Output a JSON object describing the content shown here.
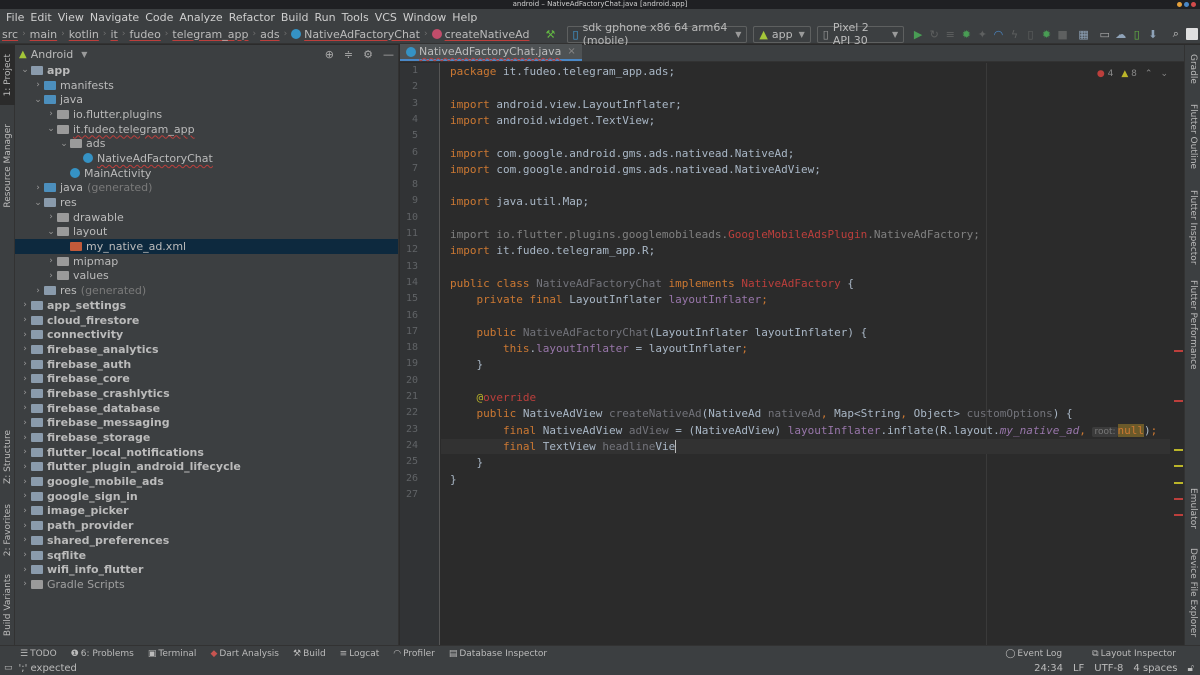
{
  "window": {
    "title": "android – NativeAdFactoryChat.java [android.app]"
  },
  "menu": [
    "File",
    "Edit",
    "View",
    "Navigate",
    "Code",
    "Analyze",
    "Refactor",
    "Build",
    "Run",
    "Tools",
    "VCS",
    "Window",
    "Help"
  ],
  "breadcrumbs": [
    "src",
    "main",
    "kotlin",
    "it",
    "fudeo",
    "telegram_app",
    "ads",
    "NativeAdFactoryChat",
    "createNativeAd"
  ],
  "toolbar": {
    "device_combo": "sdk gphone x86 64 arm64 (mobile)",
    "config_combo": "app",
    "avd_combo": "Pixel 2 API 30",
    "icons": [
      "hammer-icon",
      "run-icon",
      "apply-changes-icon",
      "apply-code-changes-icon",
      "debug-icon",
      "attach-debugger-icon",
      "profile-icon",
      "sync-icon",
      "device-icon",
      "attach-process-icon",
      "stop-icon",
      "project-structure-icon",
      "sdk-manager-icon",
      "avd-manager-icon",
      "sync-gradle-icon",
      "device-manager-icon",
      "search-icon",
      "account-icon"
    ]
  },
  "left_strip": {
    "tabs": [
      "1: Project",
      "Resource Manager",
      "Z: Structure",
      "2: Favorites",
      "Build Variants"
    ]
  },
  "project": {
    "view_mode": "Android",
    "tree": [
      {
        "label": "app",
        "depth": 0,
        "expanded": true,
        "icon": "module",
        "bold": true
      },
      {
        "label": "manifests",
        "depth": 1,
        "expanded": false,
        "icon": "folder"
      },
      {
        "label": "java",
        "depth": 1,
        "expanded": true,
        "icon": "folder"
      },
      {
        "label": "io.flutter.plugins",
        "depth": 2,
        "expanded": false,
        "icon": "package"
      },
      {
        "label": "it.fudeo.telegram_app",
        "depth": 2,
        "expanded": true,
        "icon": "package",
        "error": true
      },
      {
        "label": "ads",
        "depth": 3,
        "expanded": true,
        "icon": "package"
      },
      {
        "label": "NativeAdFactoryChat",
        "depth": 4,
        "icon": "class",
        "error": true
      },
      {
        "label": "MainActivity",
        "depth": 3,
        "icon": "activity"
      },
      {
        "label": "java",
        "suffix": "(generated)",
        "depth": 1,
        "expanded": false,
        "icon": "folder-gen"
      },
      {
        "label": "res",
        "depth": 1,
        "expanded": true,
        "icon": "res"
      },
      {
        "label": "drawable",
        "depth": 2,
        "expanded": false,
        "icon": "package"
      },
      {
        "label": "layout",
        "depth": 2,
        "expanded": true,
        "icon": "package"
      },
      {
        "label": "my_native_ad.xml",
        "depth": 3,
        "icon": "xml",
        "selected": true
      },
      {
        "label": "mipmap",
        "depth": 2,
        "expanded": false,
        "icon": "package"
      },
      {
        "label": "values",
        "depth": 2,
        "expanded": false,
        "icon": "package"
      },
      {
        "label": "res",
        "suffix": "(generated)",
        "depth": 1,
        "expanded": false,
        "icon": "res"
      },
      {
        "label": "app_settings",
        "depth": 0,
        "expanded": false,
        "icon": "module"
      },
      {
        "label": "cloud_firestore",
        "depth": 0,
        "expanded": false,
        "icon": "module"
      },
      {
        "label": "connectivity",
        "depth": 0,
        "expanded": false,
        "icon": "module"
      },
      {
        "label": "firebase_analytics",
        "depth": 0,
        "expanded": false,
        "icon": "module"
      },
      {
        "label": "firebase_auth",
        "depth": 0,
        "expanded": false,
        "icon": "module"
      },
      {
        "label": "firebase_core",
        "depth": 0,
        "expanded": false,
        "icon": "module"
      },
      {
        "label": "firebase_crashlytics",
        "depth": 0,
        "expanded": false,
        "icon": "module"
      },
      {
        "label": "firebase_database",
        "depth": 0,
        "expanded": false,
        "icon": "module"
      },
      {
        "label": "firebase_messaging",
        "depth": 0,
        "expanded": false,
        "icon": "module"
      },
      {
        "label": "firebase_storage",
        "depth": 0,
        "expanded": false,
        "icon": "module"
      },
      {
        "label": "flutter_local_notifications",
        "depth": 0,
        "expanded": false,
        "icon": "module"
      },
      {
        "label": "flutter_plugin_android_lifecycle",
        "depth": 0,
        "expanded": false,
        "icon": "module"
      },
      {
        "label": "google_mobile_ads",
        "depth": 0,
        "expanded": false,
        "icon": "module"
      },
      {
        "label": "google_sign_in",
        "depth": 0,
        "expanded": false,
        "icon": "module"
      },
      {
        "label": "image_picker",
        "depth": 0,
        "expanded": false,
        "icon": "module"
      },
      {
        "label": "path_provider",
        "depth": 0,
        "expanded": false,
        "icon": "module"
      },
      {
        "label": "shared_preferences",
        "depth": 0,
        "expanded": false,
        "icon": "module"
      },
      {
        "label": "sqflite",
        "depth": 0,
        "expanded": false,
        "icon": "module"
      },
      {
        "label": "wifi_info_flutter",
        "depth": 0,
        "expanded": false,
        "icon": "module"
      },
      {
        "label": "Gradle Scripts",
        "depth": 0,
        "expanded": false,
        "icon": "gradle",
        "plain": true
      }
    ]
  },
  "editor": {
    "tab": "NativeAdFactoryChat.java",
    "errors": "4",
    "warnings": "8",
    "current_line": 24,
    "lines": [
      [
        [
          "kw",
          "package "
        ],
        [
          "p",
          "it.fudeo.telegram_app.ads;"
        ]
      ],
      [],
      [
        [
          "kw",
          "import "
        ],
        [
          "p",
          "android.view.LayoutInflater;"
        ]
      ],
      [
        [
          "kw",
          "import "
        ],
        [
          "p",
          "android.widget.TextView;"
        ]
      ],
      [],
      [
        [
          "kw",
          "import "
        ],
        [
          "p",
          "com.google.android.gms.ads.nativead.NativeAd;"
        ]
      ],
      [
        [
          "kw",
          "import "
        ],
        [
          "p",
          "com.google.android.gms.ads.nativead.NativeAdView;"
        ]
      ],
      [],
      [
        [
          "kw",
          "import "
        ],
        [
          "p",
          "java.util.Map;"
        ]
      ],
      [],
      [
        [
          "grey",
          "import io.flutter.plugins.googlemobileads."
        ],
        [
          "err",
          "GoogleMobileAdsPlugin"
        ],
        [
          "grey",
          ".NativeAdFactory;"
        ]
      ],
      [
        [
          "kw",
          "import "
        ],
        [
          "p",
          "it.fudeo.telegram_app.R;"
        ]
      ],
      [],
      [
        [
          "kw",
          "public class "
        ],
        [
          "unused",
          "NativeAdFactoryChat "
        ],
        [
          "kw",
          "implements "
        ],
        [
          "err",
          "NativeAdFactory"
        ],
        [
          "p",
          " {"
        ]
      ],
      [
        [
          "p",
          "    "
        ],
        [
          "kw",
          "private final "
        ],
        [
          "p",
          "LayoutInflater "
        ],
        [
          "fld",
          "layoutInflater"
        ],
        [
          "kw",
          ";"
        ]
      ],
      [],
      [
        [
          "p",
          "    "
        ],
        [
          "kw",
          "public "
        ],
        [
          "unused",
          "NativeAdFactoryChat"
        ],
        [
          "p",
          "(LayoutInflater layoutInflater) {"
        ]
      ],
      [
        [
          "p",
          "        "
        ],
        [
          "kw",
          "this"
        ],
        [
          "p",
          "."
        ],
        [
          "fld",
          "layoutInflater"
        ],
        [
          "p",
          " = layoutInflater"
        ],
        [
          "kw",
          ";"
        ]
      ],
      [
        [
          "p",
          "    }"
        ]
      ],
      [],
      [
        [
          "p",
          "    "
        ],
        [
          "ann",
          "@"
        ],
        [
          "err",
          "override"
        ]
      ],
      [
        [
          "p",
          "    "
        ],
        [
          "kw",
          "public "
        ],
        [
          "p",
          "NativeAdView "
        ],
        [
          "unused",
          "createNativeAd"
        ],
        [
          "p",
          "(NativeAd "
        ],
        [
          "unused",
          "nativeAd"
        ],
        [
          "kw",
          ", "
        ],
        [
          "p",
          "Map<String"
        ],
        [
          "kw",
          ", "
        ],
        [
          "p",
          "Object> "
        ],
        [
          "unused",
          "customOptions"
        ],
        [
          "p",
          ") {"
        ]
      ],
      [
        [
          "p",
          "        "
        ],
        [
          "kw",
          "final "
        ],
        [
          "p",
          "NativeAdView "
        ],
        [
          "unused",
          "adView"
        ],
        [
          "p",
          " = (NativeAdView) "
        ],
        [
          "fld",
          "layoutInflater"
        ],
        [
          "p",
          ".inflate(R.layout."
        ],
        [
          "fldi",
          "my_native_ad"
        ],
        [
          "kw",
          ", "
        ],
        [
          "hint",
          "root:"
        ],
        [
          "nullhl",
          "null"
        ],
        [
          "p",
          ")"
        ],
        [
          "kw",
          ";"
        ]
      ],
      [
        [
          "p",
          "        "
        ],
        [
          "kw",
          "final "
        ],
        [
          "p",
          "TextView "
        ],
        [
          "unused",
          "headline"
        ],
        [
          "p",
          "Vie"
        ],
        [
          "caret",
          ""
        ]
      ],
      [
        [
          "p",
          "    }"
        ]
      ],
      [
        [
          "p",
          "}"
        ]
      ],
      []
    ]
  },
  "right_strip": {
    "tabs": [
      "Gradle",
      "Flutter Outline",
      "Flutter Inspector",
      "Flutter Performance",
      "Emulator",
      "Device File Explorer"
    ]
  },
  "bottom_tools": {
    "left": [
      {
        "label": "TODO",
        "icon": "todo-icon"
      },
      {
        "label": "6: Problems",
        "icon": "problems-icon"
      },
      {
        "label": "Terminal",
        "icon": "terminal-icon"
      },
      {
        "label": "Dart Analysis",
        "icon": "dart-analysis-icon"
      },
      {
        "label": "Build",
        "icon": "build-icon"
      },
      {
        "label": "Logcat",
        "icon": "logcat-icon"
      },
      {
        "label": "Profiler",
        "icon": "profiler-icon"
      },
      {
        "label": "Database Inspector",
        "icon": "database-icon"
      }
    ],
    "right": [
      {
        "label": "Event Log",
        "icon": "event-log-icon"
      },
      {
        "label": "Layout Inspector",
        "icon": "layout-inspector-icon"
      }
    ]
  },
  "status": {
    "message": "';' expected",
    "position": "24:34",
    "line_sep": "LF",
    "encoding": "UTF-8",
    "indent": "4 spaces"
  },
  "colors": {
    "accent": "#4a88c7",
    "error": "#bc3f3c",
    "warning": "#bbb529",
    "run_green": "#499c54",
    "selection": "#0d293e"
  }
}
